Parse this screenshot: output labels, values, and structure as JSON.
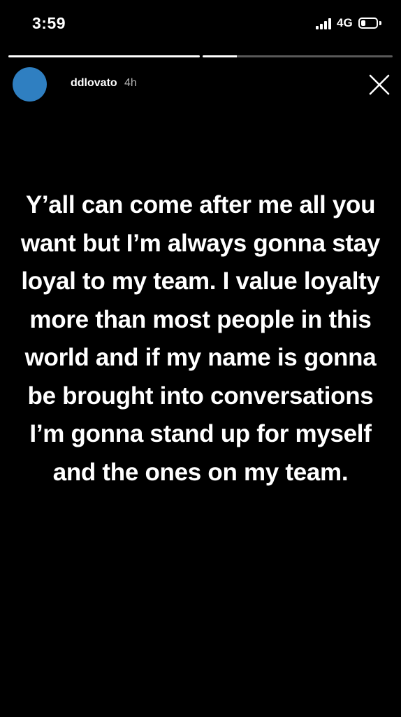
{
  "status_bar": {
    "time": "3:59",
    "network": "4G",
    "signal_icon": "cellular-signal-icon",
    "battery_icon": "battery-icon",
    "battery_level": 0.3
  },
  "story": {
    "progress": [
      1.0,
      0.18
    ],
    "username": "ddlovato",
    "age": "4h",
    "close_icon": "close-icon",
    "text": "Y’all can come after me all you want but I’m always gonna stay loyal to my team. I value loyalty more than most people in this world and if my name is gonna be brought into conversations I’m gonna stand up for myself and the ones on my team."
  },
  "colors": {
    "background": "#000000",
    "avatar": "#2f7fc1",
    "text": "#ffffff"
  }
}
